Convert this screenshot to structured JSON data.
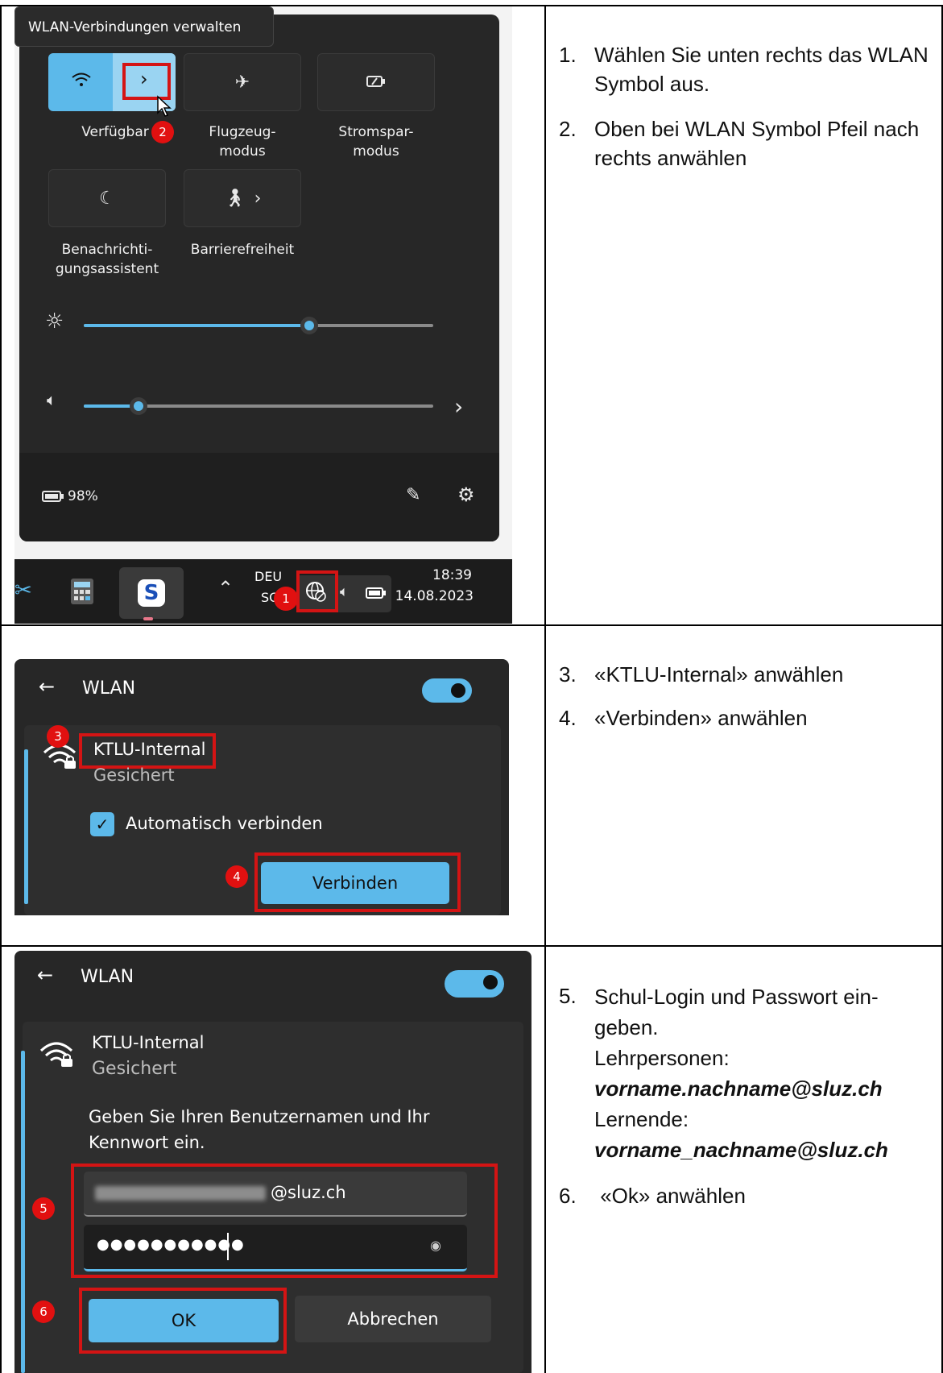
{
  "panel1": {
    "tooltip": "WLAN-Verbindungen verwalten",
    "tiles": [
      {
        "label": "Verfügbar",
        "icon": "wifi-icon"
      },
      {
        "label": "Flugzeug-\nmodus",
        "icon": "airplane-icon"
      },
      {
        "label": "Stromspar-\nmodus",
        "icon": "battery-saver-icon"
      },
      {
        "label": "Benachrichti-\ngungsassistent",
        "icon": "moon-icon"
      },
      {
        "label": "Barrierefreiheit",
        "icon": "accessibility-icon"
      }
    ],
    "brightness_level": 0.7,
    "volume_level": 0.17,
    "battery": "98%",
    "taskbar": {
      "lang_line1": "DEU",
      "lang_line2": "SG",
      "time": "18:39",
      "date": "14.08.2023"
    },
    "badge_1": "1",
    "badge_2": "2"
  },
  "panel2": {
    "title": "WLAN",
    "network_name": "KTLU-Internal",
    "network_status": "Gesichert",
    "auto_connect_label": "Automatisch verbinden",
    "connect_button": "Verbinden",
    "badge_3": "3",
    "badge_4": "4"
  },
  "panel3": {
    "title": "WLAN",
    "network_name": "KTLU-Internal",
    "network_status": "Gesichert",
    "prompt": "Geben Sie Ihren Benutzernamen und Ihr Kennwort ein.",
    "username_suffix": "@sluz.ch",
    "password_mask": "●●●●●●●●●●●",
    "ok_button": "OK",
    "cancel_button": "Abbrechen",
    "badge_5": "5",
    "badge_6": "6"
  },
  "instructions": {
    "s1_num": "1.",
    "s1_text": "Wählen Sie unten rechts das WLAN Symbol aus.",
    "s2_num": "2.",
    "s2_text": "Oben bei WLAN Symbol Pfeil nach rechts anwählen",
    "s3_num": "3.",
    "s3_text": "«KTLU-Internal» anwählen",
    "s4_num": "4.",
    "s4_text": "«Verbinden» anwählen",
    "s5_num": "5.",
    "s5_line1": "Schul-Login und Passwort ein-geben.",
    "s5_line2": "Lehrpersonen:",
    "s5_line3": "vorname.nachname@sluz.ch",
    "s5_line4": "Lernende:",
    "s5_line5": "vorname_nachname@sluz.ch",
    "s6_num": "6.",
    "s6_text": " «Ok» anwählen"
  }
}
